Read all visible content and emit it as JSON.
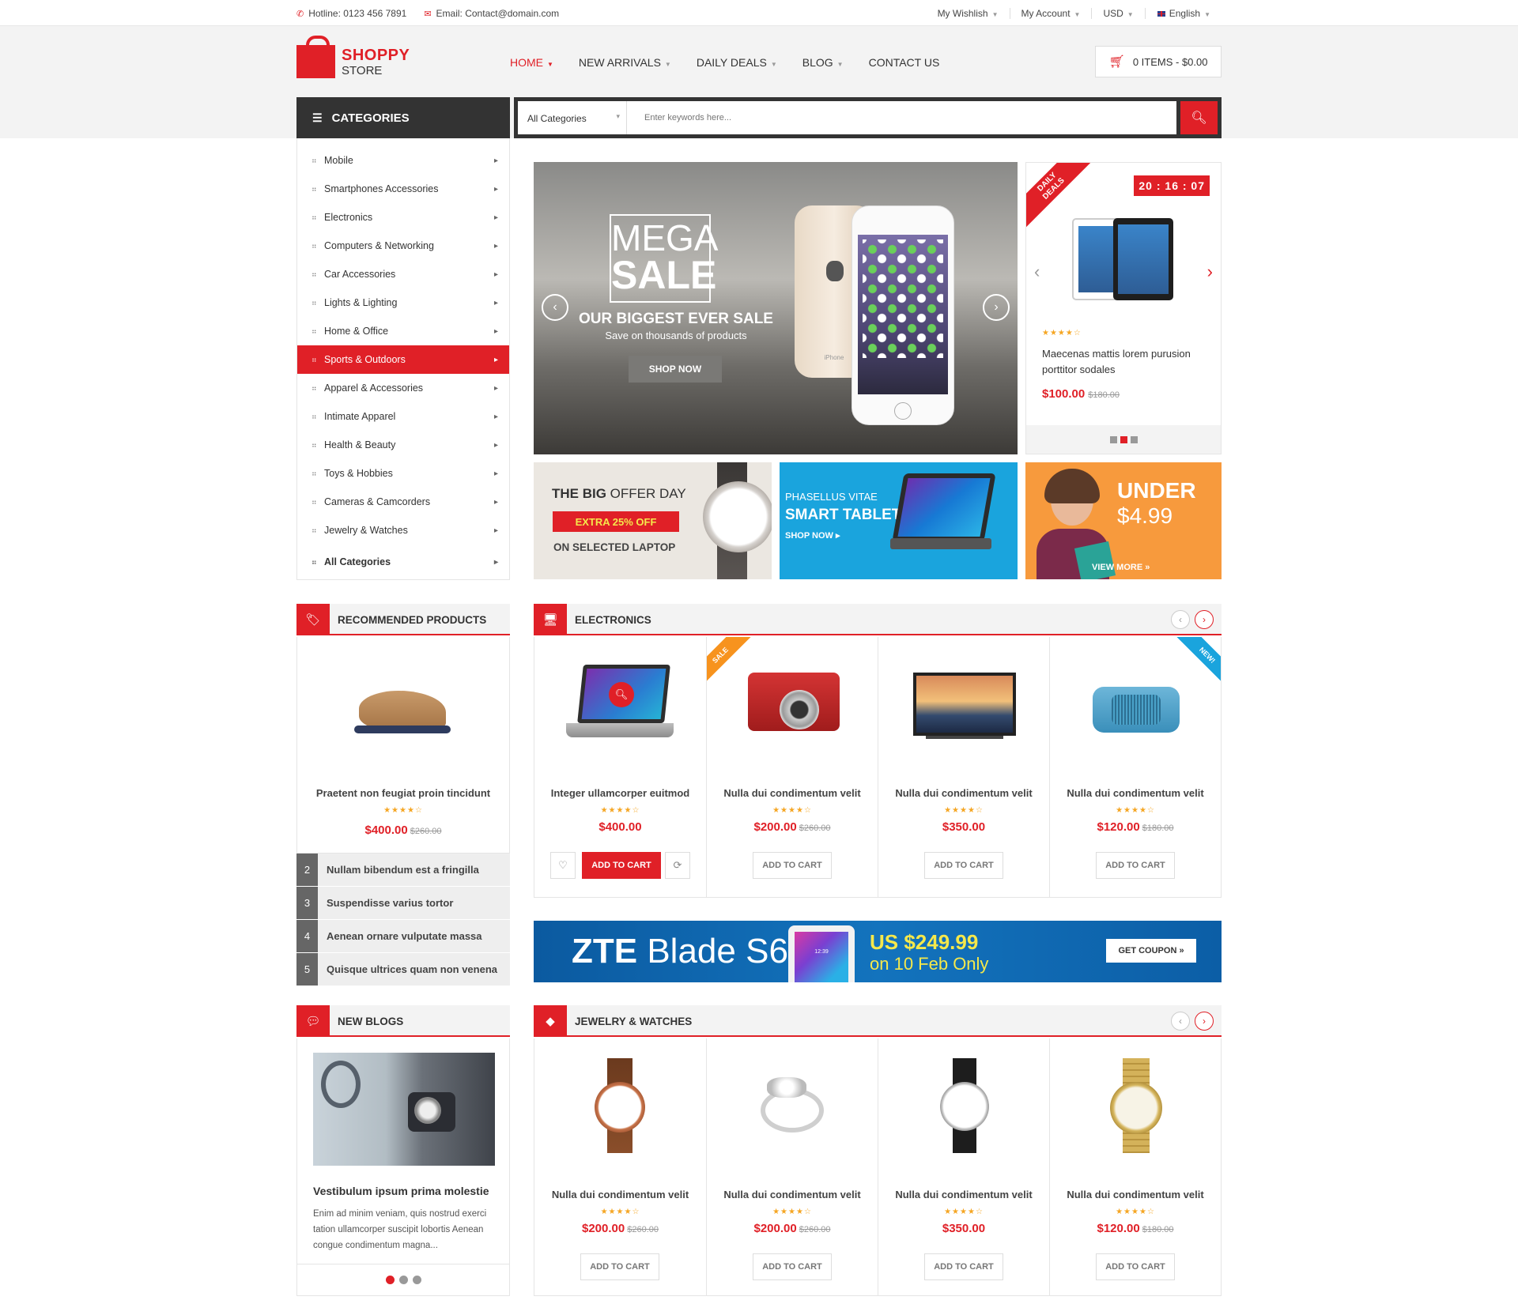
{
  "topbar": {
    "hotline": "Hotline: 0123 456 7891",
    "email": "Email: Contact@domain.com",
    "wishlist": "My Wishlish",
    "account": "My Account",
    "currency": "USD",
    "language": "English"
  },
  "brand": {
    "name1": "SHOPPY",
    "name2": "STORE",
    "accent": "#e02027"
  },
  "nav": [
    "HOME",
    "NEW ARRIVALS",
    "DAILY DEALS",
    "BLOG",
    "CONTACT US"
  ],
  "cart": {
    "label": "0 ITEMS - $0.00"
  },
  "categories_title": "CATEGORIES",
  "search": {
    "category": "All Categories",
    "placeholder": "Enter keywords here..."
  },
  "categories": [
    "Mobile",
    "Smartphones Accessories",
    "Electronics",
    "Computers & Networking",
    "Car Accessories",
    "Lights & Lighting",
    "Home & Office",
    "Sports & Outdoors",
    "Apparel & Accessories",
    "Intimate Apparel",
    "Health & Beauty",
    "Toys & Hobbies",
    "Cameras & Camcorders",
    "Jewelry & Watches",
    "All Categories"
  ],
  "slider": {
    "mega": "MEGA",
    "sale": "SALE",
    "headline": "OUR BIGGEST EVER SALE",
    "sub": "Save on thousands of products",
    "cta": "SHOP NOW",
    "phone_label": "iPhone"
  },
  "deal": {
    "ribbon1": "DAILY",
    "ribbon2": "DEALS",
    "timer": "20 : 16 : 07",
    "stars": "★★★★☆",
    "name": "Maecenas mattis lorem purusion porttitor sodales",
    "price": "$100.00",
    "old": "$180.00"
  },
  "banners": {
    "b1_title_bold": "THE BIG",
    "b1_title": " OFFER DAY",
    "b1_badge": "EXTRA 25% OFF",
    "b1_sub": "ON SELECTED LAPTOP",
    "b2_top": "PHASELLUS VITAE",
    "b2_title": "SMART TABLET",
    "b2_cta": "SHOP NOW ▸",
    "b3_top": "UNDER",
    "b3_price": "$4.99",
    "b3_cta": "VIEW MORE »"
  },
  "recommended": {
    "title": "RECOMMENDED PRODUCTS",
    "name": "Praetent non feugiat proin tincidunt",
    "stars": "★★★★☆",
    "price": "$400.00",
    "old": "$260.00",
    "list": [
      {
        "n": "2",
        "t": "Nullam bibendum est a fringilla"
      },
      {
        "n": "3",
        "t": "Suspendisse varius tortor"
      },
      {
        "n": "4",
        "t": "Aenean ornare vulputate massa"
      },
      {
        "n": "5",
        "t": "Quisque ultrices quam non venena"
      }
    ]
  },
  "electronics": {
    "title": "ELECTRONICS",
    "items": [
      {
        "name": "Integer ullamcorper euitmod",
        "stars": "★★★★☆",
        "price": "$400.00",
        "old": "",
        "btn": "ADD TO CART"
      },
      {
        "name": "Nulla dui condimentum velit",
        "stars": "★★★★☆",
        "price": "$200.00",
        "old": "$260.00",
        "btn": "ADD TO CART",
        "tag": "SALE"
      },
      {
        "name": "Nulla dui condimentum velit",
        "stars": "★★★★☆",
        "price": "$350.00",
        "old": "",
        "btn": "ADD TO CART"
      },
      {
        "name": "Nulla dui condimentum velit",
        "stars": "★★★★☆",
        "price": "$120.00",
        "old": "$180.00",
        "btn": "ADD TO CART",
        "tag": "NEW!"
      }
    ]
  },
  "zte": {
    "brand": "ZTE",
    "model": " Blade S6",
    "price": "US $249.99",
    "date": "on 10 Feb Only",
    "cta": "GET COUPON »",
    "screen_time": "12:39"
  },
  "blogs": {
    "title": "NEW BLOGS",
    "post_title": "Vestibulum ipsum prima molestie",
    "post_text": "Enim ad minim veniam, quis nostrud exerci tation ullamcorper suscipit lobortis Aenean congue condimentum magna..."
  },
  "jewelry": {
    "title": "JEWELRY & WATCHES",
    "items": [
      {
        "name": "Nulla dui condimentum velit",
        "stars": "★★★★☆",
        "price": "$200.00",
        "old": "$260.00",
        "btn": "ADD TO CART"
      },
      {
        "name": "Nulla dui condimentum velit",
        "stars": "★★★★☆",
        "price": "$200.00",
        "old": "$260.00",
        "btn": "ADD TO CART"
      },
      {
        "name": "Nulla dui condimentum velit",
        "stars": "★★★★☆",
        "price": "$350.00",
        "old": "",
        "btn": "ADD TO CART"
      },
      {
        "name": "Nulla dui condimentum velit",
        "stars": "★★★★☆",
        "price": "$120.00",
        "old": "$180.00",
        "btn": "ADD TO CART"
      }
    ]
  }
}
